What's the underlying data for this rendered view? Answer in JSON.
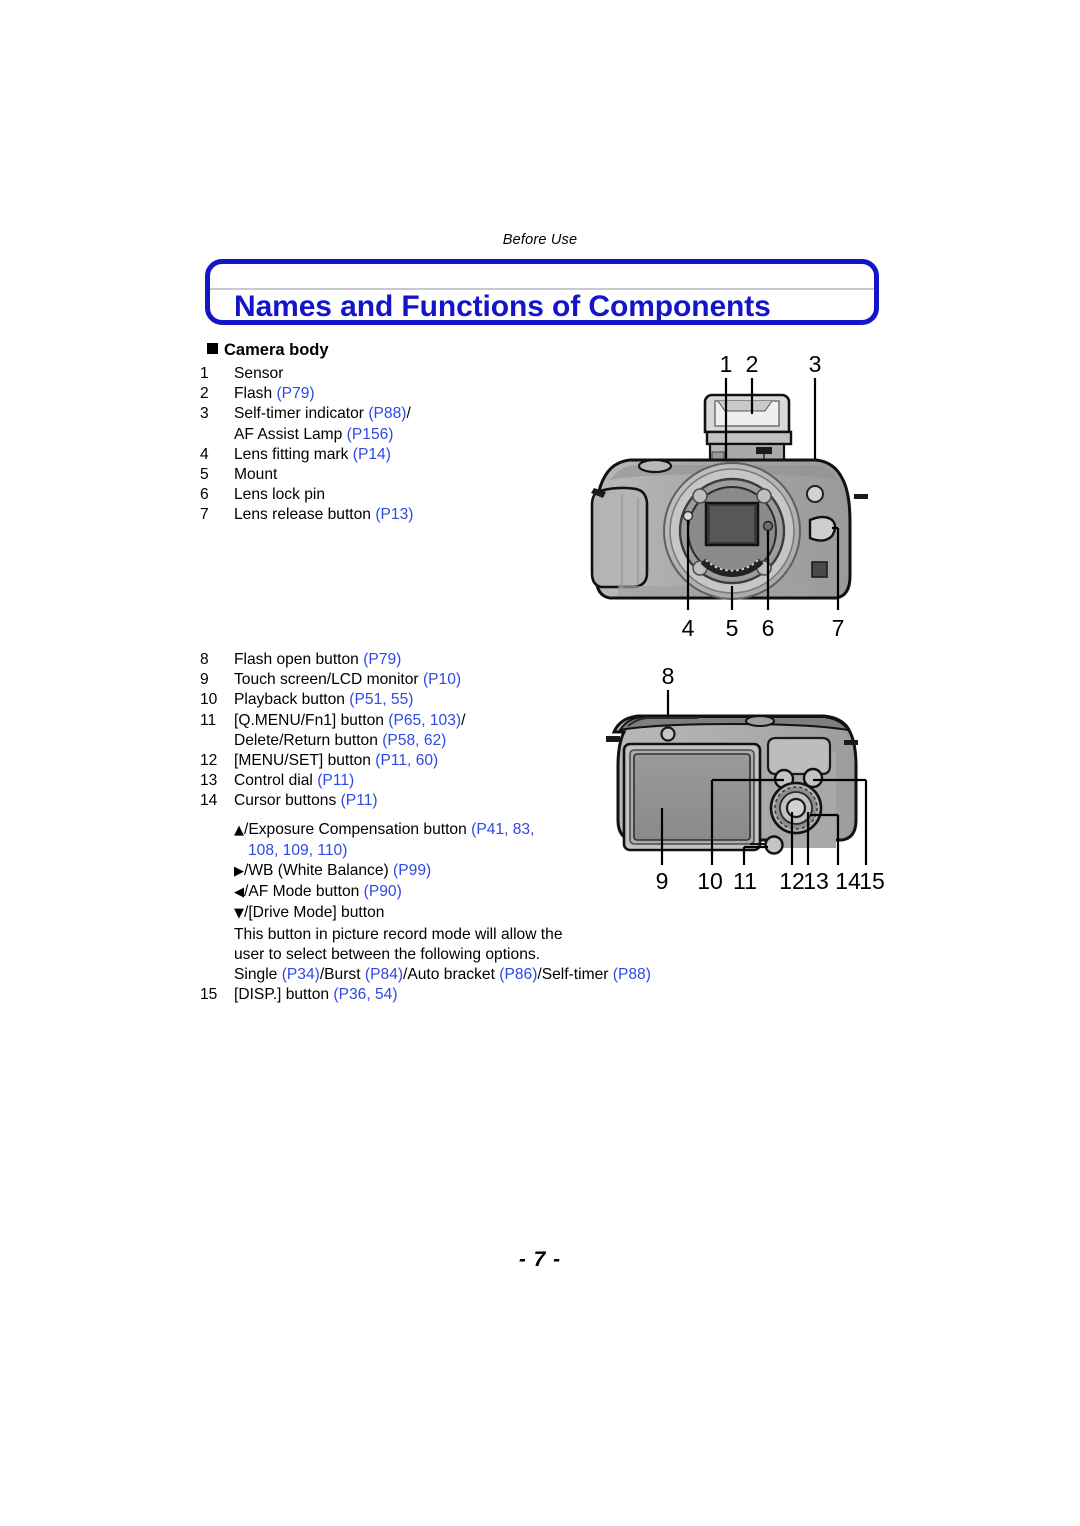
{
  "header": {
    "running_title": "Before Use",
    "page_title": "Names and Functions of Components",
    "section_heading": "Camera body"
  },
  "colors": {
    "title_blue": "#1414c8",
    "link_blue": "#2e49e6",
    "rule_gray": "#c8c8d2",
    "body_black": "#000000"
  },
  "list_front": [
    {
      "num": "1",
      "text": "Sensor"
    },
    {
      "num": "2",
      "text": "Flash ",
      "refs": "(P79)"
    },
    {
      "num": "3",
      "text": "Self-timer indicator ",
      "refs": "(P88)",
      "tail": "/",
      "cont_text": "AF Assist Lamp ",
      "cont_refs": "(P156)"
    },
    {
      "num": "4",
      "text": "Lens fitting mark ",
      "refs": "(P14)"
    },
    {
      "num": "5",
      "text": "Mount"
    },
    {
      "num": "6",
      "text": "Lens lock pin"
    },
    {
      "num": "7",
      "text": "Lens release button ",
      "refs": "(P13)"
    }
  ],
  "list_back": [
    {
      "num": "8",
      "text": "Flash open button ",
      "refs": "(P79)"
    },
    {
      "num": "9",
      "text": "Touch screen/LCD monitor ",
      "refs": "(P10)"
    },
    {
      "num": "10",
      "text": "Playback button ",
      "refs": "(P51, 55)"
    },
    {
      "num": "11",
      "text": "[Q.MENU/Fn1] button ",
      "refs": "(P65, 103)",
      "tail": "/",
      "cont_text": "Delete/Return button ",
      "cont_refs": "(P58, 62)"
    },
    {
      "num": "12",
      "text": "[MENU/SET] button ",
      "refs": "(P11, 60)"
    },
    {
      "num": "13",
      "text": "Control dial ",
      "refs": "(P11)"
    },
    {
      "num": "14",
      "text": "Cursor buttons ",
      "refs": "(P11)"
    }
  ],
  "cursor_details": {
    "up_glyph": "▲",
    "up_label": "/Exposure Compensation button ",
    "up_refs_1": "(P41, 83,",
    "up_refs_2": "108, 109, 110)",
    "right_glyph": "▶",
    "right_label": "/WB (White Balance) ",
    "right_refs": "(P99)",
    "left_glyph": "◀",
    "left_label": "/AF Mode button ",
    "left_refs": "(P90)",
    "down_glyph": "▼",
    "down_label": "/[Drive Mode] button",
    "note_line1": "This button in picture record mode will allow the",
    "note_line2": "user to select between the following options.",
    "options_pre": "Single ",
    "options_r1": "(P34)",
    "options_mid1": "/Burst ",
    "options_r2": "(P84)",
    "options_mid2": "/Auto bracket ",
    "options_r3": "(P86)",
    "options_mid3": "/Self-timer ",
    "options_r4": "(P88)"
  },
  "list_tail": [
    {
      "num": "15",
      "text": "[DISP.] button ",
      "refs": "(P36, 54)"
    }
  ],
  "figure_front": {
    "caption": "Camera body front view",
    "callouts_top": [
      "1",
      "2",
      "3"
    ],
    "callouts_bottom": [
      "4",
      "5",
      "6",
      "7"
    ]
  },
  "figure_back": {
    "caption": "Camera body rear view",
    "callout_top": "8",
    "callouts_bottom": [
      "9",
      "10",
      "11",
      "12",
      "13",
      "14",
      "15"
    ]
  },
  "footer": {
    "page_number": "- 7 -"
  }
}
